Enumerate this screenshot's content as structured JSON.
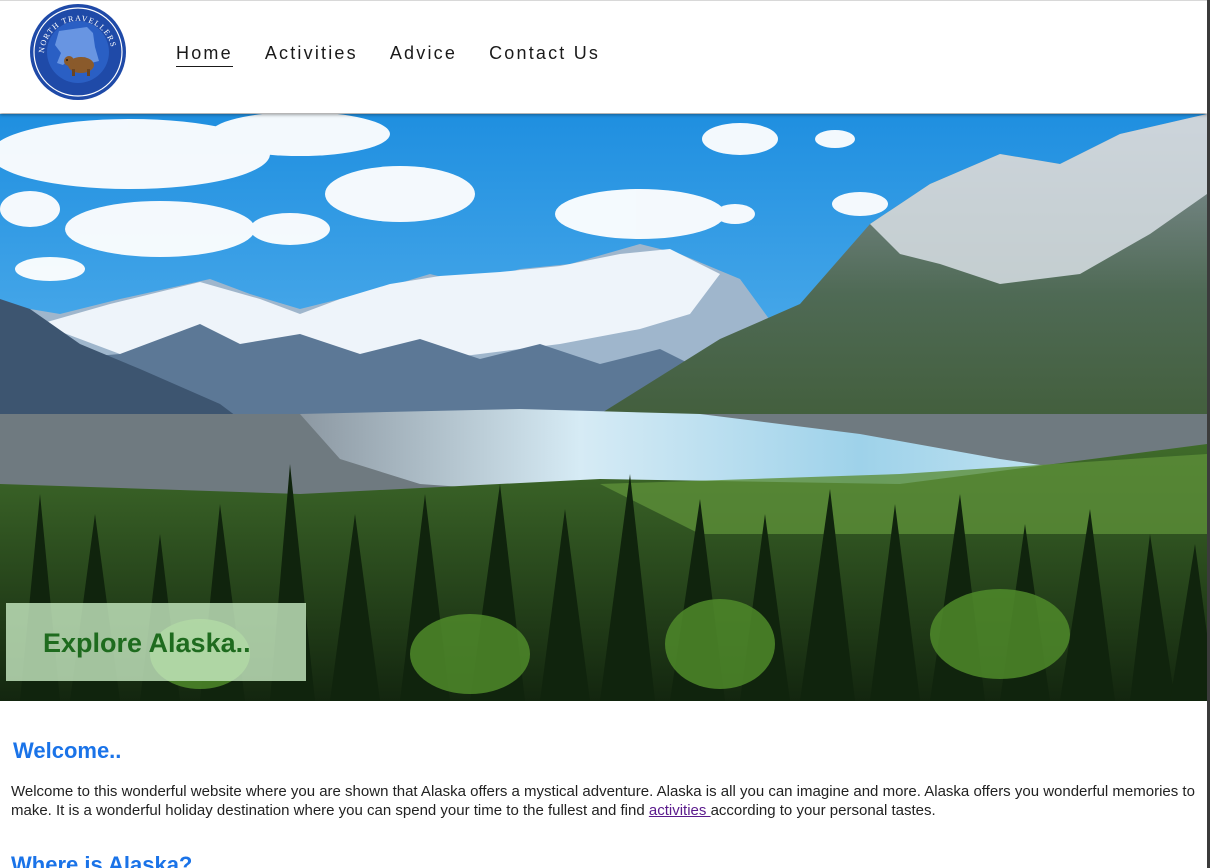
{
  "logo": {
    "ring_text": "NORTH TRAVELLERS",
    "icon": "bear-on-alaska-map-icon"
  },
  "nav": {
    "items": [
      {
        "label": "Home",
        "active": true
      },
      {
        "label": "Activities",
        "active": false
      },
      {
        "label": "Advice",
        "active": false
      },
      {
        "label": "Contact Us",
        "active": false
      }
    ]
  },
  "hero": {
    "image": "alaska-glacier-mountains-forest",
    "caption": "Explore Alaska.."
  },
  "welcome": {
    "heading": "Welcome..",
    "text_before": "Welcome to this wonderful website where you are shown that Alaska offers a mystical adventure. Alaska is all you can imagine and more. Alaska offers you wonderful memories to make. It is a wonderful holiday destination where you can spend your time to the fullest and find ",
    "link_text": "activities ",
    "text_after": "according to your personal tastes."
  },
  "where": {
    "heading": "Where is Alaska?"
  },
  "colors": {
    "heading": "#1a73e8",
    "caption_text": "#1e6b1e",
    "link": "#5a1a8c",
    "logo_blue": "#1f4aa8"
  }
}
